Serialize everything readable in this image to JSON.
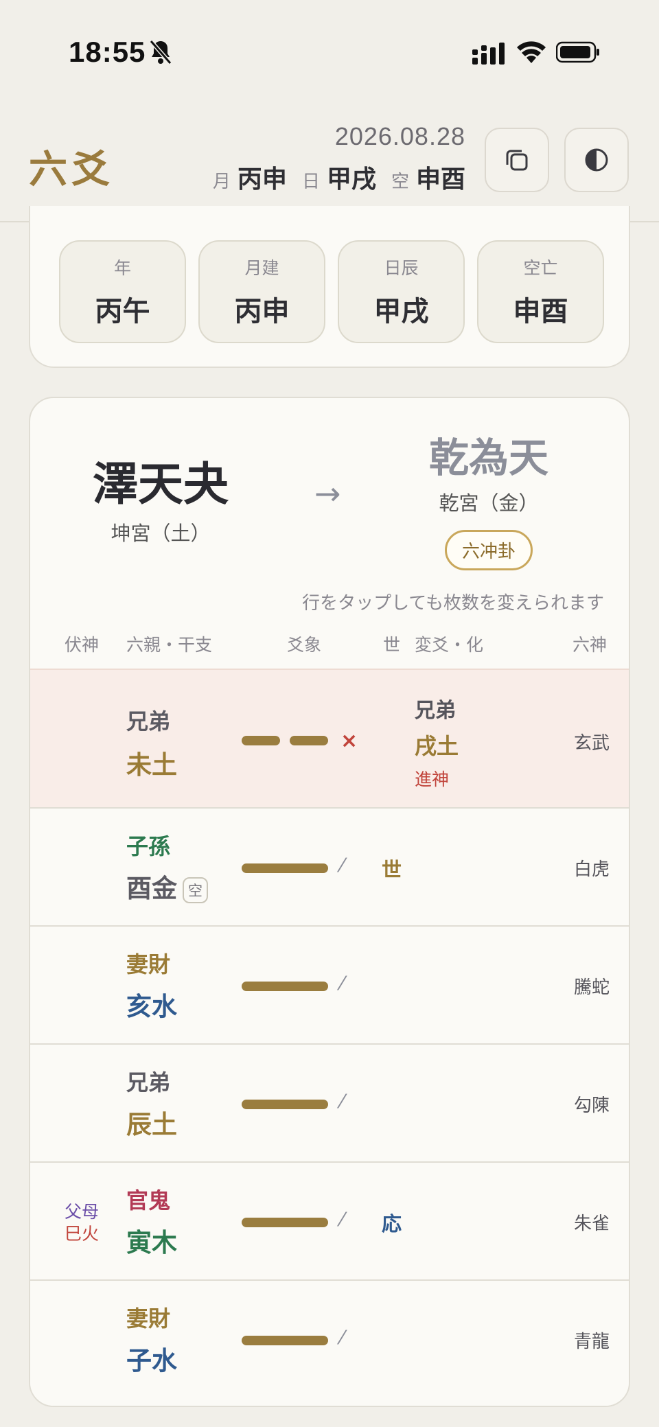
{
  "status_bar": {
    "time": "18:55",
    "icons": [
      "bell-slash-icon",
      "signal-icon",
      "wifi-icon",
      "battery-icon"
    ]
  },
  "header": {
    "logo": "六爻",
    "date": "2026.08.28",
    "month_label": "月",
    "month_value": "丙申",
    "day_label": "日",
    "day_value": "甲戌",
    "void_label": "空",
    "void_value": "申酉",
    "copy_icon": "copy-icon",
    "theme_icon": "contrast-icon"
  },
  "pillars": [
    {
      "label": "年",
      "value": "丙午"
    },
    {
      "label": "月建",
      "value": "丙申"
    },
    {
      "label": "日辰",
      "value": "甲戌"
    },
    {
      "label": "空亡",
      "value": "申酉"
    }
  ],
  "hexagram": {
    "main_name": "澤天夬",
    "main_palace": "坤宮（土）",
    "arrow": "→",
    "changed_name": "乾為天",
    "changed_palace": "乾宮（金）",
    "badge": "六冲卦"
  },
  "hint": "行をタップしても枚数を変えられます",
  "columns": {
    "fushen": "伏神",
    "relation": "六親・干支",
    "line": "爻象",
    "shi": "世",
    "change": "変爻・化",
    "god": "六神"
  },
  "rows": [
    {
      "relation": "兄弟",
      "branch": "未土",
      "line_type": "yin",
      "mark": "×",
      "moving": true,
      "change_relation": "兄弟",
      "change_branch": "戌土",
      "change_tag": "進神",
      "god": "玄武",
      "relation_color": "#5b5a62",
      "branch_color": "#9a7b35"
    },
    {
      "relation": "子孫",
      "branch": "酉金",
      "void_badge": "空",
      "line_type": "yang",
      "mark": "⁄",
      "shiying": "世",
      "god": "白虎",
      "relation_color": "#2c7a4f",
      "branch_color": "#5b5a62"
    },
    {
      "relation": "妻財",
      "branch": "亥水",
      "line_type": "yang",
      "mark": "⁄",
      "god": "騰蛇",
      "relation_color": "#9a7b35",
      "branch_color": "#2f5a8f"
    },
    {
      "relation": "兄弟",
      "branch": "辰土",
      "line_type": "yang",
      "mark": "⁄",
      "god": "勾陳",
      "relation_color": "#5b5a62",
      "branch_color": "#9a7b35"
    },
    {
      "relation": "官鬼",
      "branch": "寅木",
      "line_type": "yang",
      "mark": "⁄",
      "shiying": "応",
      "god": "朱雀",
      "fushen_relation": "父母",
      "fushen_branch": "巳火",
      "relation_color": "#b23a55",
      "branch_color": "#2c7a4f"
    },
    {
      "relation": "妻財",
      "branch": "子水",
      "line_type": "yang",
      "mark": "⁄",
      "god": "青龍",
      "relation_color": "#9a7b35",
      "branch_color": "#2f5a8f"
    }
  ]
}
